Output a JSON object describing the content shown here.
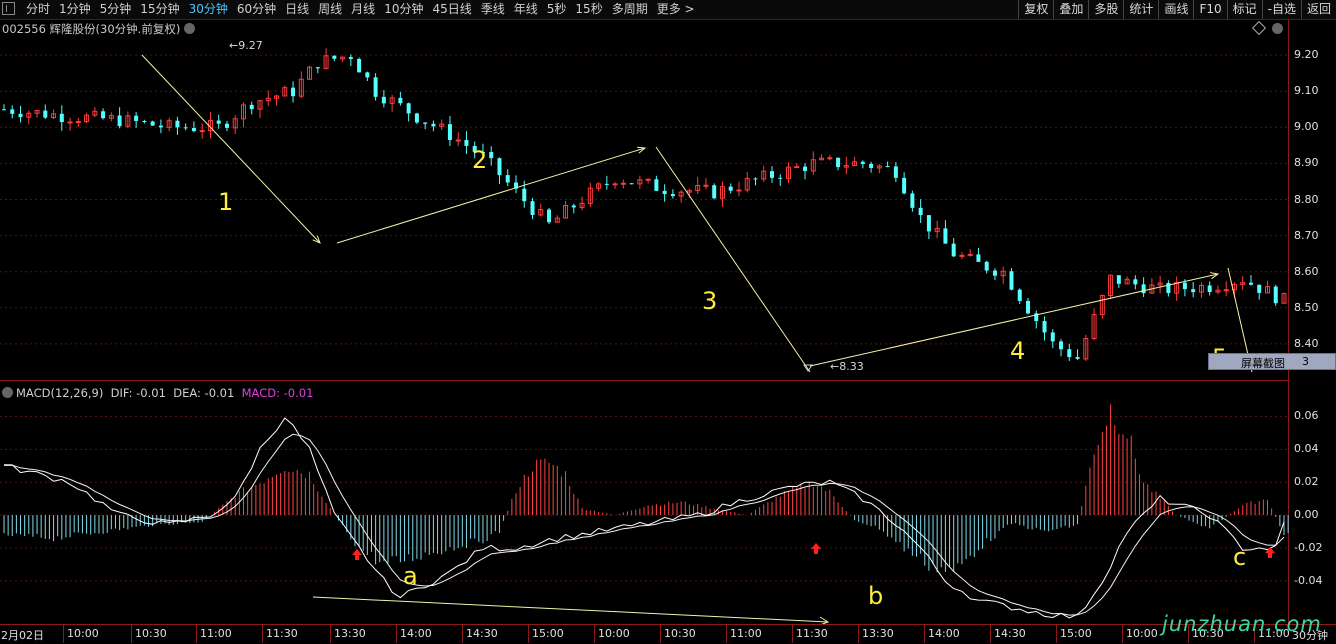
{
  "toolbar": {
    "tabs": [
      "分时",
      "1分钟",
      "5分钟",
      "15分钟",
      "30分钟",
      "60分钟",
      "日线",
      "周线",
      "月线",
      "10分钟",
      "45日线",
      "季线",
      "年线",
      "5秒",
      "15秒",
      "多周期",
      "更多 >"
    ],
    "active_tab": "30分钟",
    "right_buttons": [
      "复权",
      "叠加",
      "多股",
      "统计",
      "画线",
      "F10",
      "标记",
      "-自选",
      "返回"
    ]
  },
  "chart": {
    "title": "002556 辉隆股份(30分钟.前复权)",
    "high_label": "9.27",
    "low_label": "8.33",
    "wave_labels": [
      "1",
      "2",
      "3",
      "4",
      "5"
    ],
    "macd_title_name": "MACD(12,26,9)",
    "macd_title_dif": "DIF: -0.01",
    "macd_title_dea": "DEA: -0.01",
    "macd_title_macd": "MACD: -0.01",
    "divergence_labels": [
      "a",
      "b",
      "c"
    ],
    "screenshot_tooltip": "屏幕截图",
    "tooltip_suffix": "3",
    "period_label": "30分钟",
    "watermark": "junzhuan.com"
  },
  "chart_data": [
    {
      "type": "candlestick",
      "y_ticks": [
        9.2,
        9.1,
        9.0,
        8.9,
        8.8,
        8.7,
        8.6,
        8.5,
        8.4
      ],
      "ylim": [
        8.3,
        9.3
      ],
      "high": 9.27,
      "low": 8.33,
      "colors": {
        "up": "#ff3b3b",
        "down": "#54ffff"
      }
    },
    {
      "type": "bar",
      "name": "MACD",
      "y_ticks": [
        "0.06",
        "0.04",
        "0.02",
        "0.00",
        "-0.02",
        "-0.04"
      ],
      "ylim": [
        -0.065,
        0.07
      ],
      "dif": -0.01,
      "dea": -0.01,
      "macd": -0.01
    }
  ],
  "x_axis": {
    "labels": [
      "2月02日",
      "10:00",
      "10:30",
      "11:00",
      "11:30",
      "13:30",
      "14:00",
      "14:30",
      "15:00",
      "10:00",
      "10:30",
      "11:00",
      "11:30",
      "13:30",
      "14:00",
      "14:30",
      "15:00",
      "10:00",
      "10:30",
      "11:00"
    ]
  }
}
